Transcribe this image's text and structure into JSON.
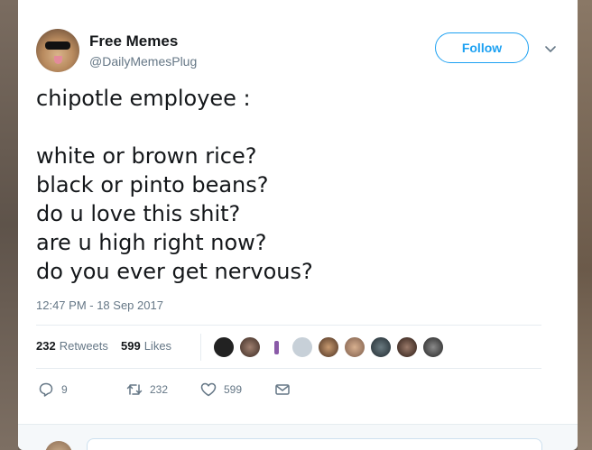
{
  "tweet": {
    "author": {
      "display_name": "Free Memes",
      "handle": "@DailyMemesPlug",
      "avatar": "pug-with-sunglasses-avatar"
    },
    "follow_label": "Follow",
    "caret_icon": "chevron-down-icon",
    "text_lines": [
      "chipotle employee :",
      "",
      "white or brown rice?",
      "black or pinto beans?",
      "do u love this shit?",
      "are u high right now?",
      "do you ever get nervous?"
    ],
    "timestamp": "12:47 PM - 18 Sep 2017",
    "stats": {
      "retweets_count": "232",
      "retweets_label": "Retweets",
      "likes_count": "599",
      "likes_label": "Likes"
    },
    "actions": {
      "reply_count": "9",
      "retweet_count": "232",
      "like_count": "599"
    }
  },
  "colors": {
    "accent": "#1da1f2",
    "text_primary": "#14171a",
    "text_secondary": "#657786",
    "divider": "#e6ecf0"
  }
}
